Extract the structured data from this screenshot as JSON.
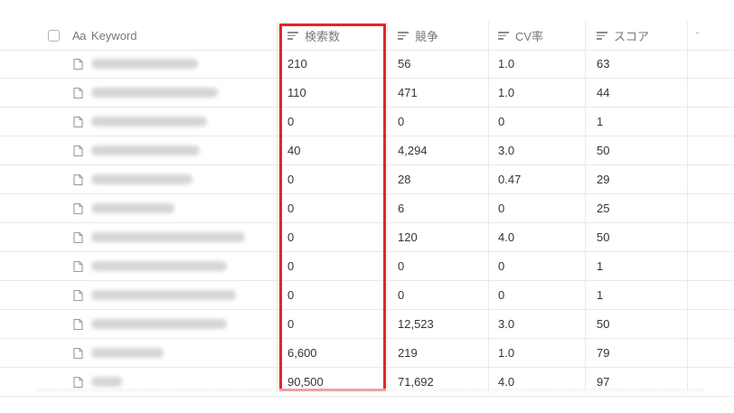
{
  "header": {
    "keyword_prefix": "Aa",
    "keyword": "Keyword",
    "search_volume": "検索数",
    "competition": "競争",
    "cv_rate": "CV率",
    "score": "スコア"
  },
  "rows": [
    {
      "search": "210",
      "comp": "56",
      "cv": "1.0",
      "score": "63"
    },
    {
      "search": "110",
      "comp": "471",
      "cv": "1.0",
      "score": "44"
    },
    {
      "search": "0",
      "comp": "0",
      "cv": "0",
      "score": "1"
    },
    {
      "search": "40",
      "comp": "4,294",
      "cv": "3.0",
      "score": "50"
    },
    {
      "search": "0",
      "comp": "28",
      "cv": "0.47",
      "score": "29"
    },
    {
      "search": "0",
      "comp": "6",
      "cv": "0",
      "score": "25"
    },
    {
      "search": "0",
      "comp": "120",
      "cv": "4.0",
      "score": "50"
    },
    {
      "search": "0",
      "comp": "0",
      "cv": "0",
      "score": "1"
    },
    {
      "search": "0",
      "comp": "0",
      "cv": "0",
      "score": "1"
    },
    {
      "search": "0",
      "comp": "12,523",
      "cv": "3.0",
      "score": "50"
    },
    {
      "search": "6,600",
      "comp": "219",
      "cv": "1.0",
      "score": "79"
    },
    {
      "search": "90,500",
      "comp": "71,692",
      "cv": "4.0",
      "score": "97"
    }
  ],
  "colors": {
    "highlight_border": "#e0252f",
    "text": "#37352f",
    "header_text": "#787774",
    "grid_line": "#e9e9e7"
  },
  "icons": {
    "select_all": "checkbox-icon",
    "title_column": "text-aa-icon",
    "number_columns": "number-property-icon",
    "row_page": "page-icon"
  }
}
